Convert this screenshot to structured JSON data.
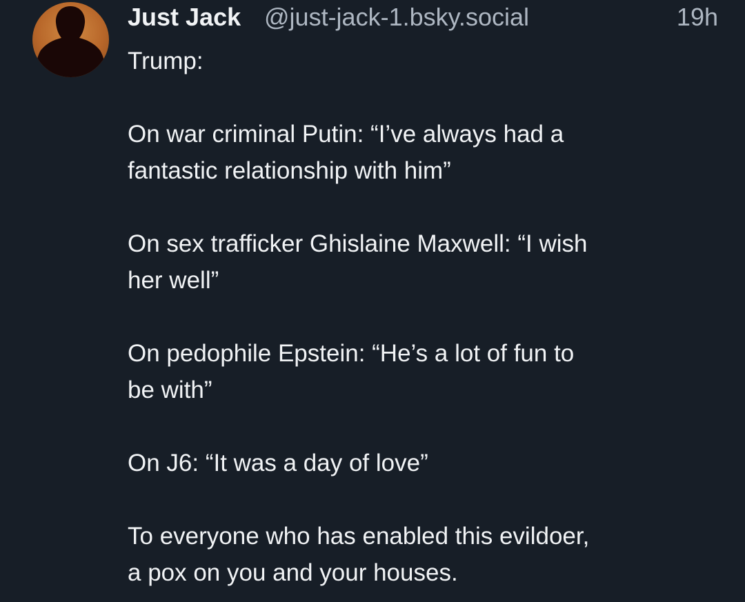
{
  "post": {
    "author": {
      "display_name": "Just Jack",
      "handle": "@just-jack-1.bsky.social",
      "avatar_icon": "person-silhouette-icon"
    },
    "timestamp": "19h",
    "paragraphs": [
      [
        "Trump:"
      ],
      [
        "On war criminal Putin: “I’ve always had a",
        "fantastic relationship with him”"
      ],
      [
        "On sex trafficker Ghislaine Maxwell: “I wish",
        "her well”"
      ],
      [
        "On pedophile Epstein: “He’s a lot of fun to",
        "be with”"
      ],
      [
        "On J6: “It was a day of love”"
      ],
      [
        "To everyone who has enabled this evildoer,",
        "a pox on you and your houses."
      ]
    ]
  },
  "colors": {
    "background": "#171e27",
    "text_primary": "#f1f3f5",
    "text_secondary": "#aeb7c2",
    "avatar_accent": "#c47632"
  }
}
